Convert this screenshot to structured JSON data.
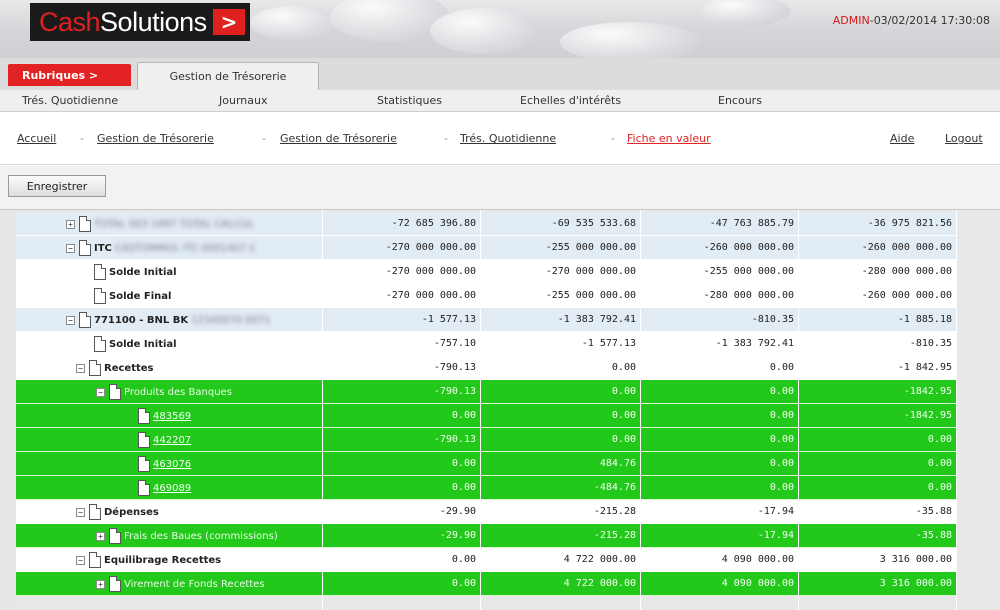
{
  "header": {
    "logo_text_a": "C",
    "logo_text_b": "ash",
    "logo_text_c": "Solutions",
    "logo_arrow": ">",
    "user": "ADMIN",
    "datetime": "-03/02/2014 17:30:08"
  },
  "tabs": {
    "rubriques": "Rubriques >",
    "gestion": "Gestion de Trésorerie"
  },
  "subnav": [
    "Trés. Quotidienne",
    "Journaux",
    "Statistiques",
    "Echelles d'intérêts",
    "Encours"
  ],
  "breadcrumb": {
    "items": [
      "Accueil",
      "Gestion de Trésorerie",
      "Gestion de Trésorerie",
      "Trés. Quotidienne"
    ],
    "current": "Fiche en valeur",
    "separator": "-",
    "help": "Aide",
    "logout": "Logout"
  },
  "toolbar": {
    "save": "Enregistrer"
  },
  "grid": {
    "rows": [
      {
        "indent": 50,
        "toggle": "+",
        "label": "",
        "blurred": "TOTAL 003 1897 TOTAL CALCUL",
        "style": "blue",
        "values": [
          "-72 685 396.80",
          "-69 535 533.68",
          "-47 763 885.79",
          "-36 975 821.56"
        ]
      },
      {
        "indent": 50,
        "toggle": "-",
        "label": "ITC",
        "blurred": "CASTOMMOL ITC 0001407 C",
        "style": "blue",
        "values": [
          "-270 000 000.00",
          "-255 000 000.00",
          "-260 000 000.00",
          "-260 000 000.00"
        ]
      },
      {
        "indent": 74,
        "toggle": "",
        "label": "Solde Initial",
        "style": "white",
        "values": [
          "-270 000 000.00",
          "-270 000 000.00",
          "-255 000 000.00",
          "-280 000 000.00"
        ]
      },
      {
        "indent": 74,
        "toggle": "",
        "label": "Solde Final",
        "style": "white",
        "values": [
          "-270 000 000.00",
          "-255 000 000.00",
          "-280 000 000.00",
          "-260 000 000.00"
        ]
      },
      {
        "indent": 50,
        "toggle": "-",
        "label": "771100 - BNL BK",
        "blurred": "12345670 0071",
        "style": "blue",
        "values": [
          "-1 577.13",
          "-1 383 792.41",
          "-810.35",
          "-1 885.18"
        ]
      },
      {
        "indent": 74,
        "toggle": "",
        "label": "Solde Initial",
        "style": "white",
        "values": [
          "-757.10",
          "-1 577.13",
          "-1 383 792.41",
          "-810.35"
        ]
      },
      {
        "indent": 60,
        "toggle": "-",
        "label": "Recettes",
        "style": "white",
        "values": [
          "-790.13",
          "0.00",
          "0.00",
          "-1 842.95"
        ]
      },
      {
        "indent": 80,
        "toggle": "-",
        "label": "Produits des Banques",
        "style": "green",
        "values": [
          "-790.13",
          "0.00",
          "0.00",
          "-1842.95"
        ]
      },
      {
        "indent": 118,
        "toggle": "",
        "link": "483569",
        "style": "green",
        "values": [
          "0.00",
          "0.00",
          "0.00",
          "-1842.95"
        ]
      },
      {
        "indent": 118,
        "toggle": "",
        "link": "442207",
        "style": "green",
        "values": [
          "-790.13",
          "0.00",
          "0.00",
          "0.00"
        ]
      },
      {
        "indent": 118,
        "toggle": "",
        "link": "463076",
        "style": "green",
        "values": [
          "0.00",
          "484.76",
          "0.00",
          "0.00"
        ]
      },
      {
        "indent": 118,
        "toggle": "",
        "link": "469089",
        "style": "green",
        "values": [
          "0.00",
          "-484.76",
          "0.00",
          "0.00"
        ]
      },
      {
        "indent": 60,
        "toggle": "-",
        "label": "Dépenses",
        "style": "white",
        "values": [
          "-29.90",
          "-215.28",
          "-17.94",
          "-35.88"
        ]
      },
      {
        "indent": 80,
        "toggle": "+",
        "label": "Frais des Baues (commissions)",
        "style": "green",
        "values": [
          "-29.90",
          "-215.28",
          "-17.94",
          "-35.88"
        ]
      },
      {
        "indent": 60,
        "toggle": "-",
        "label": "Equilibrage Recettes",
        "style": "white",
        "values": [
          "0.00",
          "4 722 000.00",
          "4 090 000.00",
          "3 316 000.00"
        ]
      },
      {
        "indent": 80,
        "toggle": "+",
        "label": "Virement de Fonds Recettes",
        "style": "green",
        "values": [
          "0.00",
          "4 722 000.00",
          "4 090 000.00",
          "3 316 000.00"
        ]
      }
    ]
  },
  "colors": {
    "green": "#22c81a",
    "blue_row": "#e2ecf4",
    "accent_red": "#e32323"
  }
}
